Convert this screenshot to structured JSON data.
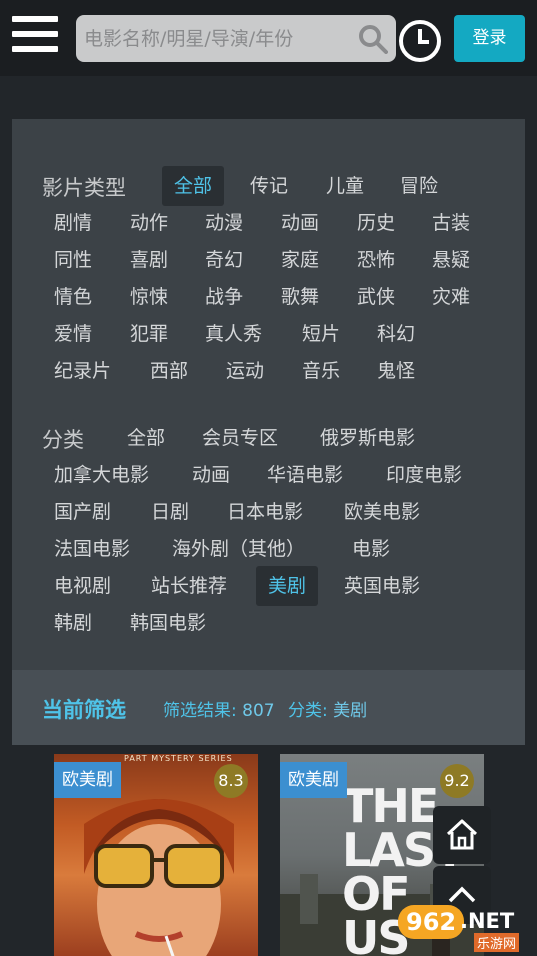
{
  "header": {
    "search_placeholder": "电影名称/明星/导演/年份",
    "login_label": "登录"
  },
  "filters": {
    "genre": {
      "label": "影片类型",
      "active": "全部",
      "rows": [
        [
          "全部",
          "传记",
          "儿童",
          "冒险"
        ],
        [
          "剧情",
          "动作",
          "动漫",
          "动画",
          "历史",
          "古装"
        ],
        [
          "同性",
          "喜剧",
          "奇幻",
          "家庭",
          "恐怖",
          "悬疑"
        ],
        [
          "情色",
          "惊悚",
          "战争",
          "歌舞",
          "武侠",
          "灾难"
        ],
        [
          "爱情",
          "犯罪",
          "真人秀",
          "短片",
          "科幻"
        ],
        [
          "纪录片",
          "西部",
          "运动",
          "音乐",
          "鬼怪"
        ]
      ]
    },
    "category": {
      "label": "分类",
      "active": "美剧",
      "rows": [
        [
          "全部",
          "会员专区",
          "俄罗斯电影"
        ],
        [
          "加拿大电影",
          "动画",
          "华语电影",
          "印度电影"
        ],
        [
          "国产剧",
          "日剧",
          "日本电影",
          "欧美电影"
        ],
        [
          "法国电影",
          "海外剧（其他）",
          "电影"
        ],
        [
          "电视剧",
          "站长推荐",
          "美剧",
          "英国电影"
        ],
        [
          "韩剧",
          "韩国电影"
        ]
      ]
    }
  },
  "current": {
    "title": "当前筛选",
    "result_label": "筛选结果:",
    "result_count": "807",
    "category_label": "分类:",
    "category_value": "美剧"
  },
  "movies": [
    {
      "badge": "欧美剧",
      "score": "8.3",
      "poster_text": "PART MYSTERY SERIES"
    },
    {
      "badge": "欧美剧",
      "score": "9.2",
      "poster_text": "THE LAST OF US"
    }
  ],
  "watermark": {
    "brand": "962",
    "net": ".NET",
    "sub": "乐游网"
  },
  "colors": {
    "accent": "#4fc3e8",
    "login": "#14a9c2",
    "badge": "#3c8fd0"
  }
}
